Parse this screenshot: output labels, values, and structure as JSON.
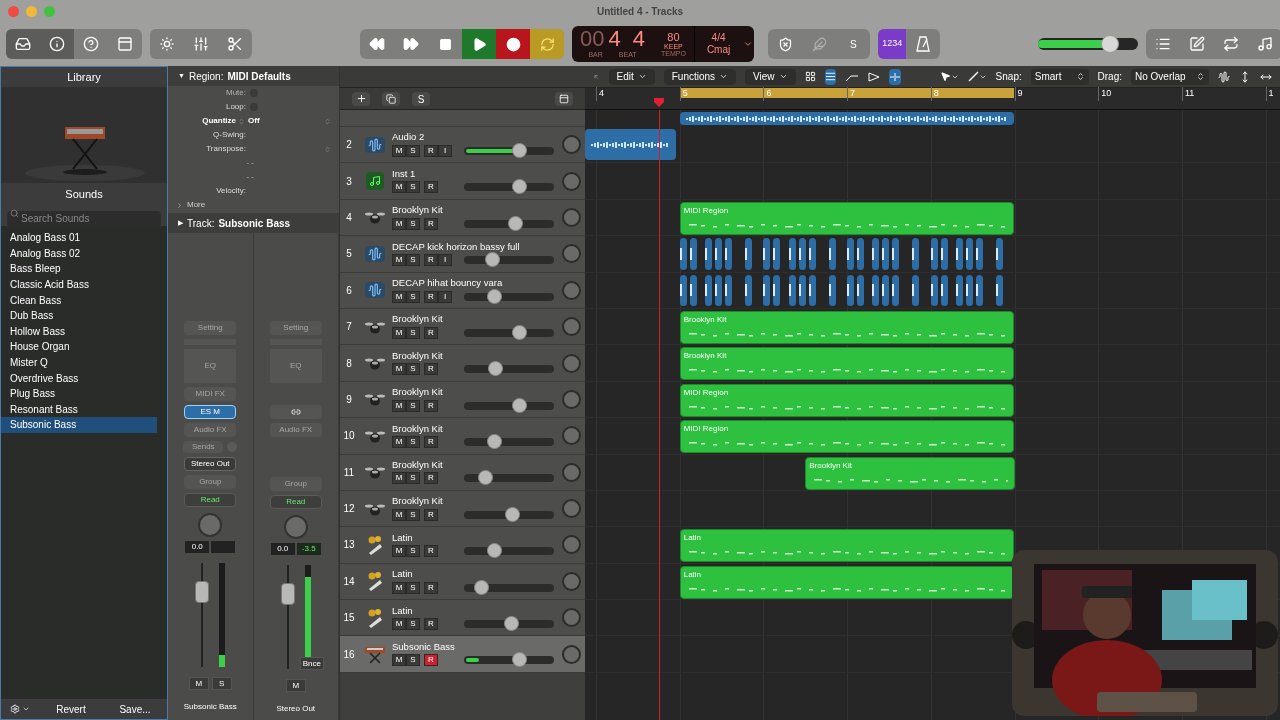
{
  "window": {
    "title": "Untitled 4 - Tracks"
  },
  "transport": {
    "play": {
      "on": true
    },
    "record": {
      "on": true
    },
    "cycle": {
      "on": true
    }
  },
  "lcd": {
    "bar_dim": "00",
    "bar": "4",
    "beat": "4",
    "bar_label": "BAR",
    "beat_label": "BEAT",
    "tempo": "80",
    "tempo_mode": "KEEP",
    "tempo_label": "TEMPO",
    "signature": "4/4",
    "key": "Cmaj"
  },
  "toolbar": {
    "solo": "S",
    "count_in": {
      "label": "1234",
      "on": true
    },
    "master": {
      "level": 0.72
    }
  },
  "library": {
    "title": "Library",
    "section": "Sounds",
    "search_placeholder": "Search Sounds",
    "items": [
      {
        "label": "Analog Bass 01",
        "selected": false
      },
      {
        "label": "Analog Bass 02",
        "selected": false
      },
      {
        "label": "Bass Bleep",
        "selected": false
      },
      {
        "label": "Classic Acid Bass",
        "selected": false
      },
      {
        "label": "Clean Bass",
        "selected": false
      },
      {
        "label": "Dub Bass",
        "selected": false
      },
      {
        "label": "Hollow Bass",
        "selected": false
      },
      {
        "label": "House Organ",
        "selected": false
      },
      {
        "label": "Mister Q",
        "selected": false
      },
      {
        "label": "Overdrive Bass",
        "selected": false
      },
      {
        "label": "Plug Bass",
        "selected": false
      },
      {
        "label": "Resonant Bass",
        "selected": false
      },
      {
        "label": "Subsonic Bass",
        "selected": true
      }
    ],
    "revert": "Revert",
    "save": "Save..."
  },
  "inspector": {
    "region_toggle": "▼",
    "region_label": "Region:",
    "region_name": "MIDI Defaults",
    "params": [
      {
        "kind": "checkbox",
        "label": "Mute:",
        "checked": false
      },
      {
        "kind": "checkbox",
        "label": "Loop:",
        "checked": false
      },
      {
        "kind": "select",
        "label": "Quantize",
        "value": "Off"
      },
      {
        "kind": "text",
        "label": "Q-Swing:"
      },
      {
        "kind": "stepper",
        "label": "Transpose:"
      },
      {
        "kind": "dashes",
        "value": "- -"
      },
      {
        "kind": "dashes",
        "value": "- -"
      },
      {
        "kind": "text",
        "label": "Velocity:"
      }
    ],
    "more": "More",
    "track_toggle": "▶",
    "track_label": "Track:",
    "track_name": "Subsonic Bass"
  },
  "strips": [
    {
      "name": "Subsonic Bass",
      "slots": [
        {
          "kind": "dim",
          "label": "Setting"
        },
        {
          "kind": "gap"
        },
        {
          "kind": "eq",
          "label": "EQ"
        },
        {
          "kind": "dim",
          "label": "MIDI FX"
        },
        {
          "kind": "instrument",
          "label": "ES M",
          "selected": true
        },
        {
          "kind": "dim",
          "label": "Audio FX"
        },
        {
          "kind": "sends",
          "label": "Sends"
        },
        {
          "kind": "output",
          "label": "Stereo Out"
        },
        {
          "kind": "dim",
          "label": "Group"
        },
        {
          "kind": "automation",
          "label": "Read"
        }
      ],
      "pan": "0.0",
      "fader": {
        "level": 0.78
      },
      "meter": {
        "level": 0.12
      },
      "buttons": [
        "M",
        "S"
      ]
    },
    {
      "name": "Stereo Out",
      "slots": [
        {
          "kind": "dim",
          "label": "Setting"
        },
        {
          "kind": "gap"
        },
        {
          "kind": "eq",
          "label": "EQ"
        },
        {
          "kind": "blank"
        },
        {
          "kind": "link"
        },
        {
          "kind": "dim",
          "label": "Audio FX"
        },
        {
          "kind": "blank"
        },
        {
          "kind": "blank"
        },
        {
          "kind": "dim",
          "label": "Group"
        },
        {
          "kind": "automation",
          "label": "Read"
        }
      ],
      "pan": "0.0",
      "peak": "-3.5",
      "fader": {
        "level": 0.78
      },
      "meter": {
        "level": 0.88
      },
      "bounce": "Bnce",
      "buttons": [
        "M"
      ]
    }
  ],
  "tracks_toolbar": {
    "menus": [
      "Edit",
      "Functions",
      "View"
    ],
    "snap_label": "Snap:",
    "snap": "Smart",
    "drag_label": "Drag:",
    "drag": "No Overlap",
    "solo": "S"
  },
  "ruler": {
    "bars": [
      "4",
      "5",
      "6",
      "7",
      "8",
      "9",
      "10",
      "11",
      "1"
    ]
  },
  "top_regions": [
    {
      "kind": "audio"
    }
  ],
  "tracks": [
    {
      "number": "2",
      "name": "Audio 2",
      "kind": "audio",
      "mute": "M",
      "solo": "S",
      "record": "R",
      "input": "I",
      "armed": false,
      "selected": false,
      "volume": {
        "level": 0.61
      },
      "meter": {
        "level": 0.62
      },
      "regions": [
        {
          "kind": "audio"
        }
      ]
    },
    {
      "number": "3",
      "name": "Inst 1",
      "kind": "inst",
      "mute": "M",
      "solo": "S",
      "record": "R",
      "armed": false,
      "selected": false,
      "volume": {
        "level": 0.61
      }
    },
    {
      "number": "4",
      "name": "Brooklyn Kit",
      "kind": "drum",
      "mute": "M",
      "solo": "S",
      "record": "R",
      "armed": false,
      "selected": false,
      "volume": {
        "level": 0.57
      },
      "regions": [
        {
          "kind": "midi",
          "label": "MIDI Region"
        }
      ]
    },
    {
      "number": "5",
      "name": "DECAP kick horizon bassy full",
      "kind": "audio",
      "mute": "M",
      "solo": "S",
      "record": "R",
      "input": "I",
      "armed": false,
      "selected": false,
      "volume": {
        "level": 0.31
      },
      "regions": [
        {
          "kind": "slices"
        }
      ]
    },
    {
      "number": "6",
      "name": "DECAP hihat bouncy vara",
      "kind": "audio",
      "mute": "M",
      "solo": "S",
      "record": "R",
      "input": "I",
      "armed": false,
      "selected": false,
      "volume": {
        "level": 0.33
      },
      "regions": [
        {
          "kind": "slices"
        }
      ]
    },
    {
      "number": "7",
      "name": "Brooklyn Kit",
      "kind": "drum",
      "mute": "M",
      "solo": "S",
      "record": "R",
      "armed": false,
      "selected": false,
      "volume": {
        "level": 0.61
      },
      "regions": [
        {
          "kind": "midi",
          "label": "Brooklyn Kit"
        }
      ]
    },
    {
      "number": "8",
      "name": "Brooklyn Kit",
      "kind": "drum",
      "mute": "M",
      "solo": "S",
      "record": "R",
      "armed": false,
      "selected": false,
      "volume": {
        "level": 0.34
      },
      "regions": [
        {
          "kind": "midi",
          "label": "Brooklyn Kit"
        }
      ]
    },
    {
      "number": "9",
      "name": "Brooklyn Kit",
      "kind": "drum",
      "mute": "M",
      "solo": "S",
      "record": "R",
      "armed": false,
      "selected": false,
      "volume": {
        "level": 0.61
      },
      "regions": [
        {
          "kind": "midi",
          "label": "MIDI Region"
        }
      ]
    },
    {
      "number": "10",
      "name": "Brooklyn Kit",
      "kind": "drum",
      "mute": "M",
      "solo": "S",
      "record": "R",
      "armed": false,
      "selected": false,
      "volume": {
        "level": 0.33
      },
      "regions": [
        {
          "kind": "midi",
          "label": "MIDI Region"
        }
      ]
    },
    {
      "number": "11",
      "name": "Brooklyn Kit",
      "kind": "drum",
      "mute": "M",
      "solo": "S",
      "record": "R",
      "armed": false,
      "selected": false,
      "volume": {
        "level": 0.23
      },
      "regions": [
        {
          "kind": "midi",
          "label": "Brooklyn Kit"
        }
      ]
    },
    {
      "number": "12",
      "name": "Brooklyn Kit",
      "kind": "drum",
      "mute": "M",
      "solo": "S",
      "record": "R",
      "armed": false,
      "selected": false,
      "volume": {
        "level": 0.53
      }
    },
    {
      "number": "13",
      "name": "Latin",
      "kind": "latin",
      "mute": "M",
      "solo": "S",
      "record": "R",
      "armed": false,
      "selected": false,
      "volume": {
        "level": 0.33
      },
      "regions": [
        {
          "kind": "midi",
          "label": "Latin"
        }
      ]
    },
    {
      "number": "14",
      "name": "Latin",
      "kind": "latin",
      "mute": "M",
      "solo": "S",
      "record": "R",
      "armed": false,
      "selected": false,
      "volume": {
        "level": 0.19
      },
      "regions": [
        {
          "kind": "midi",
          "label": "Latin"
        }
      ]
    },
    {
      "number": "15",
      "name": "Latin",
      "kind": "latin",
      "mute": "M",
      "solo": "S",
      "record": "R",
      "armed": false,
      "selected": false,
      "volume": {
        "level": 0.52
      }
    },
    {
      "number": "16",
      "name": "Subsonic Bass",
      "kind": "synth",
      "mute": "M",
      "solo": "S",
      "record": "R",
      "armed": true,
      "selected": true,
      "volume": {
        "level": 0.61
      },
      "meter": {
        "level": 0.15
      }
    }
  ]
}
